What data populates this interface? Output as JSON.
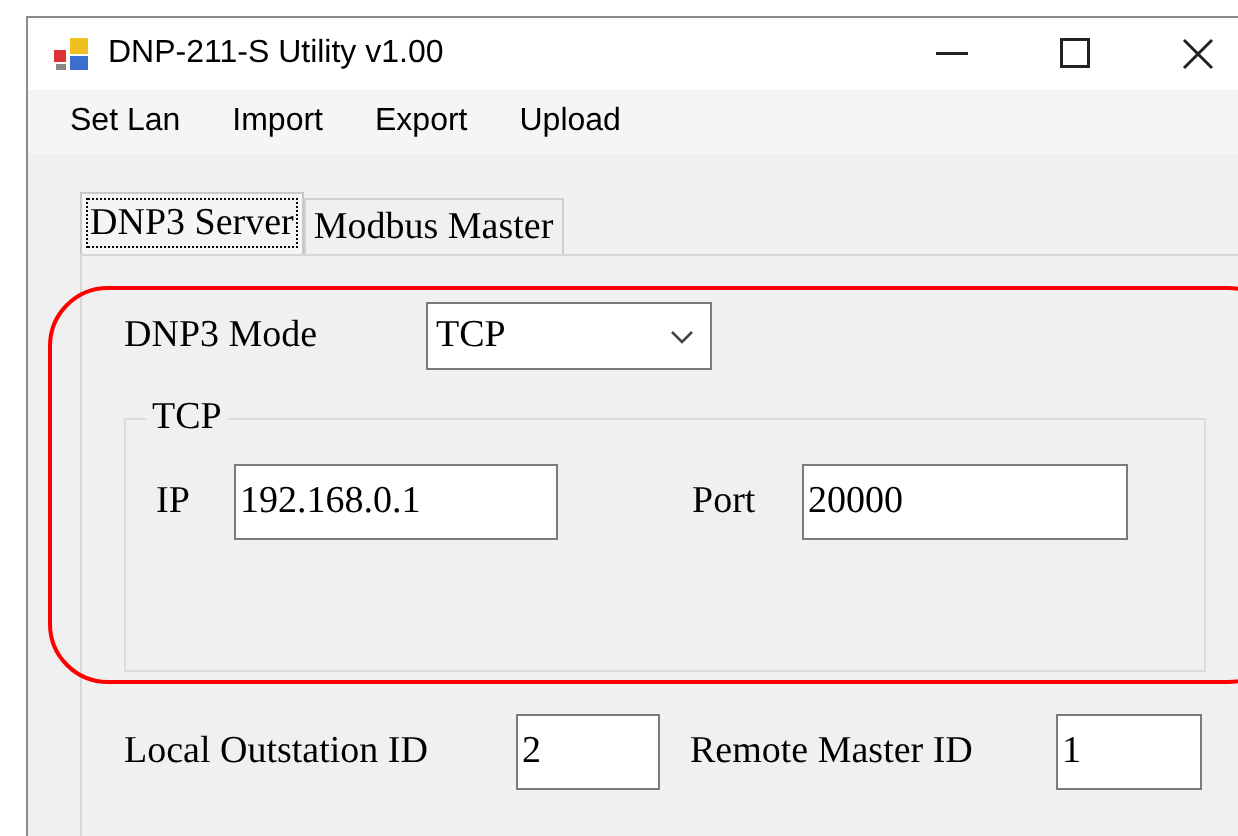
{
  "window": {
    "title": "DNP-211-S Utility v1.00"
  },
  "menu": [
    "Set Lan",
    "Import",
    "Export",
    "Upload"
  ],
  "tabs": [
    {
      "label": "DNP3 Server",
      "selected": true
    },
    {
      "label": "Modbus Master",
      "selected": false
    }
  ],
  "mode": {
    "label": "DNP3 Mode",
    "value": "TCP"
  },
  "tcp_group": {
    "legend": "TCP",
    "ip": {
      "label": "IP",
      "value": "192.168.0.1"
    },
    "port": {
      "label": "Port",
      "value": "20000"
    }
  },
  "ids": [
    {
      "label": "Local Outstation ID",
      "value": "2"
    },
    {
      "label": "Remote Master ID",
      "value": "1"
    }
  ]
}
